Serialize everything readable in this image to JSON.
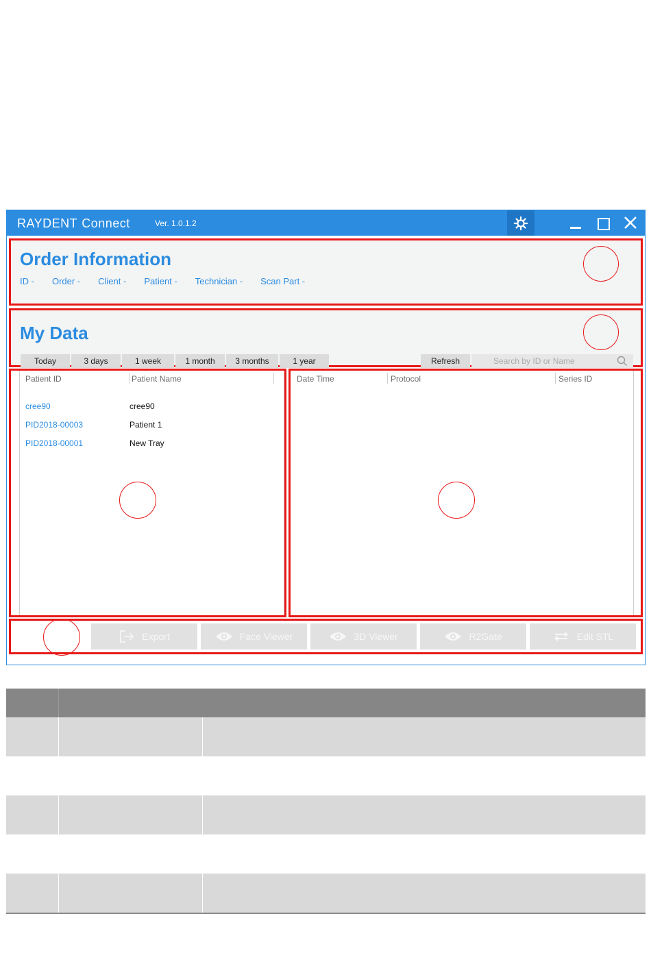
{
  "app": {
    "brand_main": "RAYDENT",
    "brand_sub": "Connect",
    "version": "Ver. 1.0.1.2"
  },
  "order_info": {
    "title": "Order Information",
    "fields": [
      "ID -",
      "Order -",
      "Client -",
      "Patient -",
      "Technician -",
      "Scan Part -"
    ]
  },
  "my_data": {
    "title": "My Data",
    "periods": [
      "Today",
      "3 days",
      "1 week",
      "1 month",
      "3 months",
      "1 year"
    ],
    "refresh_label": "Refresh",
    "search_placeholder": "Search by ID or Name"
  },
  "patients": {
    "columns": [
      "Patient ID",
      "Patient Name"
    ],
    "rows": [
      {
        "id": "cree90",
        "name": "cree90"
      },
      {
        "id": "PID2018-00003",
        "name": "Patient 1"
      },
      {
        "id": "PID2018-00001",
        "name": "New Tray"
      }
    ]
  },
  "series": {
    "columns": [
      "Date Time",
      "Protocol",
      "Series ID"
    ]
  },
  "actions": [
    "Export",
    "Face Viewer",
    "3D Viewer",
    "R2Gate",
    "Edit STL"
  ],
  "colors": {
    "accent": "#2b8ce0",
    "highlight": "#e81818",
    "disabled_button": "#e1e1e1"
  },
  "icons": {
    "settings": "gear-icon",
    "export": "export-icon",
    "viewer": "eye-icon",
    "edit": "swap-arrows-icon"
  }
}
